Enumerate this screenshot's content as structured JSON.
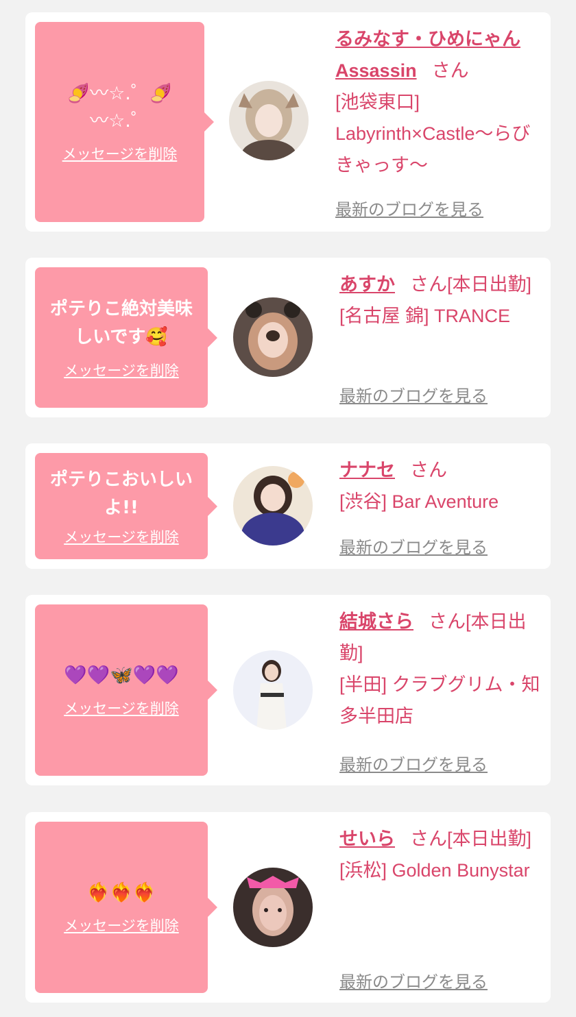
{
  "delete_label": "メッセージを削除",
  "blog_label": "最新のブログを見る",
  "colors": {
    "background": "#f2f2f2",
    "bubble": "#fd9aa8",
    "accent": "#d9456a",
    "muted_link": "#8a8a8a"
  },
  "cards": [
    {
      "message": "🍠〰☆.゜🍠\n〰☆.゜",
      "name": "るみなす・ひめにゃん Assassin",
      "suffix": "さん",
      "shop": "[池袋東口] Labyrinth×Castle〜らびきゃっす〜"
    },
    {
      "message": "ポテりこ絶対美味しいです🥰",
      "name": "あすか",
      "suffix": "さん[本日出勤]",
      "shop": "[名古屋 錦] TRANCE"
    },
    {
      "message": "ポテりこおいしいよ!!",
      "name": "ナナセ",
      "suffix": "さん",
      "shop": "[渋谷] Bar Aventure"
    },
    {
      "message": "💜💜🦋💜💜",
      "name": "結城さら",
      "suffix": "さん[本日出勤]",
      "shop": "[半田] クラブグリム・知多半田店"
    },
    {
      "message": "❤️‍🔥❤️‍🔥❤️‍🔥",
      "name": "せいら",
      "suffix": "さん[本日出勤]",
      "shop": "[浜松] Golden Bunystar"
    }
  ]
}
